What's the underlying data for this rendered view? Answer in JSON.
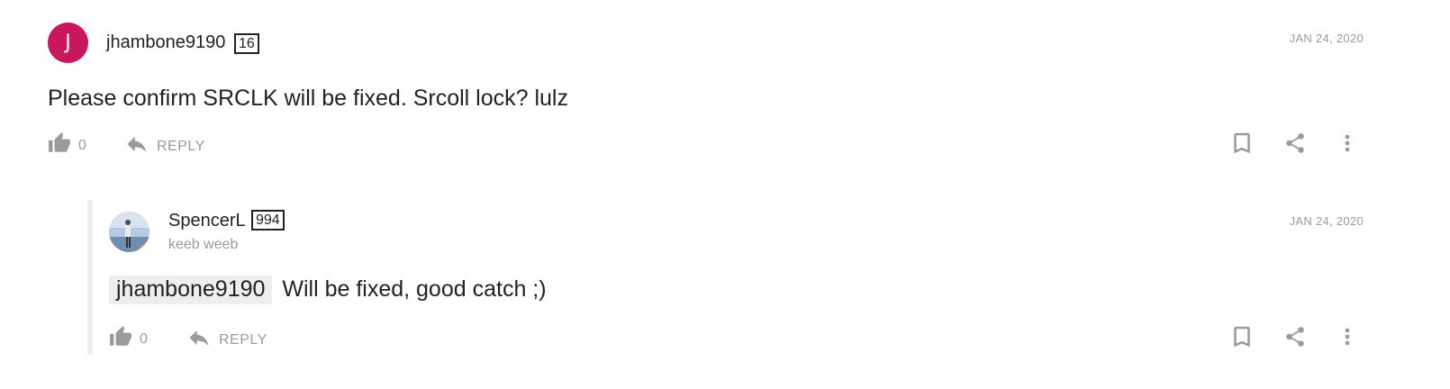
{
  "comments": [
    {
      "avatar_letter": "J",
      "avatar_color": "#c8175d",
      "username": "jhambone9190",
      "badge": "16",
      "date": "JAN 24, 2020",
      "text": "Please confirm SRCLK will be fixed. Srcoll lock? lulz",
      "vote_count": "0",
      "reply_label": "REPLY"
    },
    {
      "username": "SpencerL",
      "badge": "994",
      "subtitle": "keeb weeb",
      "date": "JAN 24, 2020",
      "mention": "jhambone9190",
      "text": "Will be fixed, good catch ;)",
      "vote_count": "0",
      "reply_label": "REPLY"
    }
  ],
  "icons": {
    "vote": "thumbs-up-icon",
    "reply": "reply-arrow-icon",
    "bookmark": "bookmark-icon",
    "share": "share-icon",
    "more": "more-vertical-icon"
  },
  "colors": {
    "icon_gray": "#9a9a9a",
    "accent": "#c8175d"
  }
}
